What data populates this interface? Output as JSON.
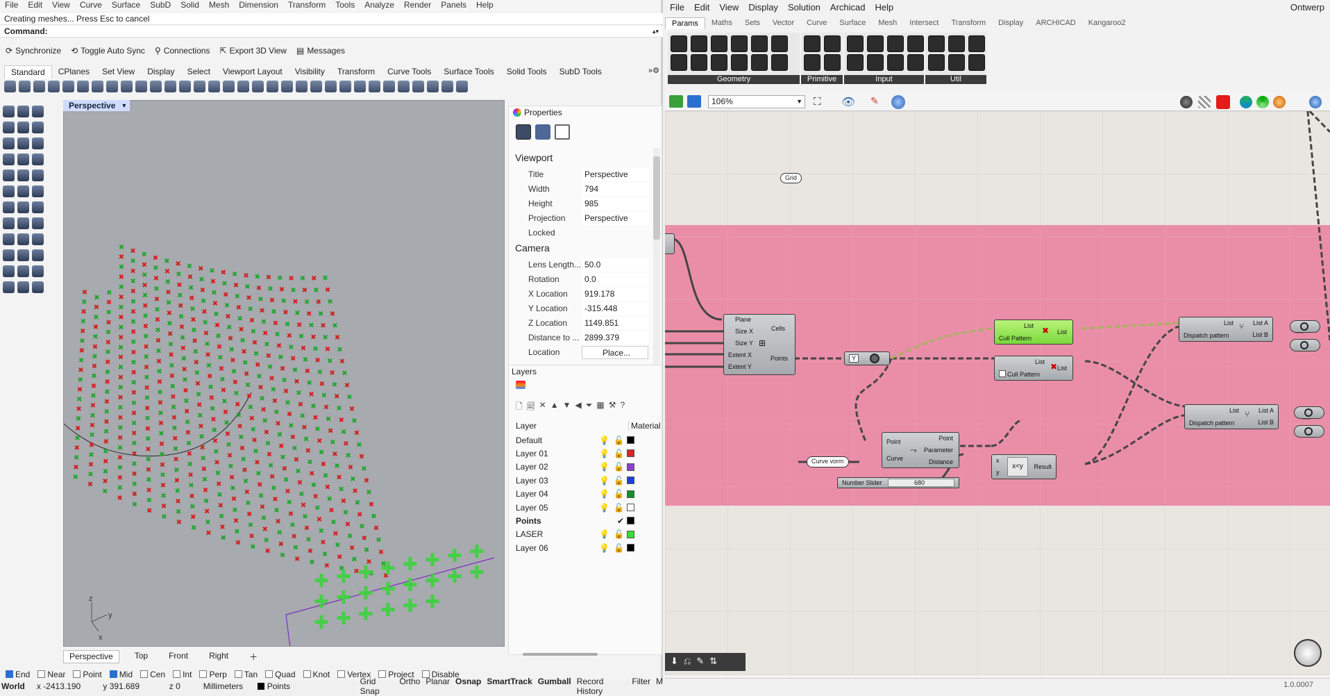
{
  "rhino": {
    "menu": [
      "File",
      "Edit",
      "View",
      "Curve",
      "Surface",
      "SubD",
      "Solid",
      "Mesh",
      "Dimension",
      "Transform",
      "Tools",
      "Analyze",
      "Render",
      "Panels",
      "Help"
    ],
    "history_line": "Creating meshes... Press Esc to cancel",
    "command_label": "Command:",
    "toolbar": [
      {
        "label": "Synchronize"
      },
      {
        "label": "Toggle Auto Sync"
      },
      {
        "label": "Connections"
      },
      {
        "label": "Export 3D View"
      },
      {
        "label": "Messages"
      }
    ],
    "tabs": [
      "Standard",
      "CPlanes",
      "Set View",
      "Display",
      "Select",
      "Viewport Layout",
      "Visibility",
      "Transform",
      "Curve Tools",
      "Surface Tools",
      "Solid Tools",
      "SubD Tools"
    ],
    "active_tab": "Standard",
    "viewport_label": "Perspective",
    "viewport_tabs": [
      "Perspective",
      "Top",
      "Front",
      "Right"
    ],
    "axis_labels": {
      "x": "x",
      "y": "y",
      "z": "z"
    },
    "properties": {
      "panel_title": "Properties",
      "viewport_section": "Viewport",
      "camera_section": "Camera",
      "viewport_rows": [
        {
          "key": "Title",
          "value": "Perspective"
        },
        {
          "key": "Width",
          "value": "794"
        },
        {
          "key": "Height",
          "value": "985"
        },
        {
          "key": "Projection",
          "value": "Perspective"
        },
        {
          "key": "Locked",
          "value": ""
        }
      ],
      "camera_rows": [
        {
          "key": "Lens Length...",
          "value": "50.0"
        },
        {
          "key": "Rotation",
          "value": "0.0"
        },
        {
          "key": "X Location",
          "value": "919.178"
        },
        {
          "key": "Y Location",
          "value": "-315.448"
        },
        {
          "key": "Z Location",
          "value": "1149.851"
        },
        {
          "key": "Distance to ...",
          "value": "2899.379"
        },
        {
          "key": "Location",
          "value": "Place..."
        }
      ]
    },
    "layers": {
      "panel_title": "Layers",
      "header_layer": "Layer",
      "header_material": "Material",
      "rows": [
        {
          "name": "Default",
          "color": "#000000"
        },
        {
          "name": "Layer 01",
          "color": "#d92626"
        },
        {
          "name": "Layer 02",
          "color": "#8a3fd1"
        },
        {
          "name": "Layer 03",
          "color": "#1d3fe0"
        },
        {
          "name": "Layer 04",
          "color": "#15902b"
        },
        {
          "name": "Layer 05",
          "color": "#ffffff"
        },
        {
          "name": "Points",
          "color": "#000000",
          "current": true
        },
        {
          "name": "LASER",
          "color": "#35e035"
        },
        {
          "name": "Layer 06",
          "color": "#000000"
        }
      ]
    },
    "osnaps": [
      {
        "label": "End",
        "on": true
      },
      {
        "label": "Near",
        "on": false
      },
      {
        "label": "Point",
        "on": false
      },
      {
        "label": "Mid",
        "on": true
      },
      {
        "label": "Cen",
        "on": false
      },
      {
        "label": "Int",
        "on": false
      },
      {
        "label": "Perp",
        "on": false
      },
      {
        "label": "Tan",
        "on": false
      },
      {
        "label": "Quad",
        "on": false
      },
      {
        "label": "Knot",
        "on": false
      },
      {
        "label": "Vertex",
        "on": false
      },
      {
        "label": "Project",
        "on": false
      },
      {
        "label": "Disable",
        "on": false
      }
    ],
    "status": {
      "cplane": "World",
      "x": "x -2413.190",
      "y": "y 391.689",
      "z": "z 0",
      "units": "Millimeters",
      "layer": "Points",
      "toggles": [
        "Grid Snap",
        "Ortho",
        "Planar",
        "Osnap",
        "SmartTrack",
        "Gumball",
        "Record History",
        "Filter",
        "M"
      ]
    }
  },
  "grasshopper": {
    "menu": [
      "File",
      "Edit",
      "View",
      "Display",
      "Solution",
      "Archicad",
      "Help"
    ],
    "doc_name": "Ontwerp",
    "tabs": [
      "Params",
      "Maths",
      "Sets",
      "Vector",
      "Curve",
      "Surface",
      "Mesh",
      "Intersect",
      "Transform",
      "Display",
      "ARCHICAD",
      "Kangaroo2"
    ],
    "active_tab": "Params",
    "ribbon_groups": [
      "Geometry",
      "Primitive",
      "Input",
      "Util"
    ],
    "zoom": "106%",
    "group_label": "Grid",
    "components": {
      "grid": {
        "inputs": [
          "Plane",
          "Size X",
          "Size Y",
          "Extent X",
          "Extent Y"
        ],
        "outputs": [
          "Cells",
          "Points"
        ]
      },
      "cull1": {
        "inputs": [
          "List",
          "Cull Pattern"
        ],
        "outputs": [
          "List"
        ]
      },
      "cull2": {
        "inputs": [
          "List",
          "Cull Pattern"
        ],
        "outputs": [
          "List"
        ]
      },
      "dispatch1": {
        "inputs": [
          "List",
          "Dispatch pattern"
        ],
        "outputs": [
          "List A",
          "List B"
        ]
      },
      "dispatch2": {
        "inputs": [
          "List",
          "Dispatch pattern"
        ],
        "outputs": [
          "List A",
          "List B"
        ]
      },
      "curve_closest": {
        "inputs": [
          "Point",
          "Curve"
        ],
        "outputs": [
          "Point",
          "Parameter",
          "Distance"
        ]
      },
      "compare": {
        "inputs": [
          "x",
          "y"
        ],
        "op": "x<y",
        "outputs": [
          "Result"
        ]
      },
      "curve_param": "Curve vorm",
      "slider": {
        "label": "Number Slider",
        "value": "680"
      },
      "param_y": "Y"
    },
    "version": "1.0.0007"
  }
}
